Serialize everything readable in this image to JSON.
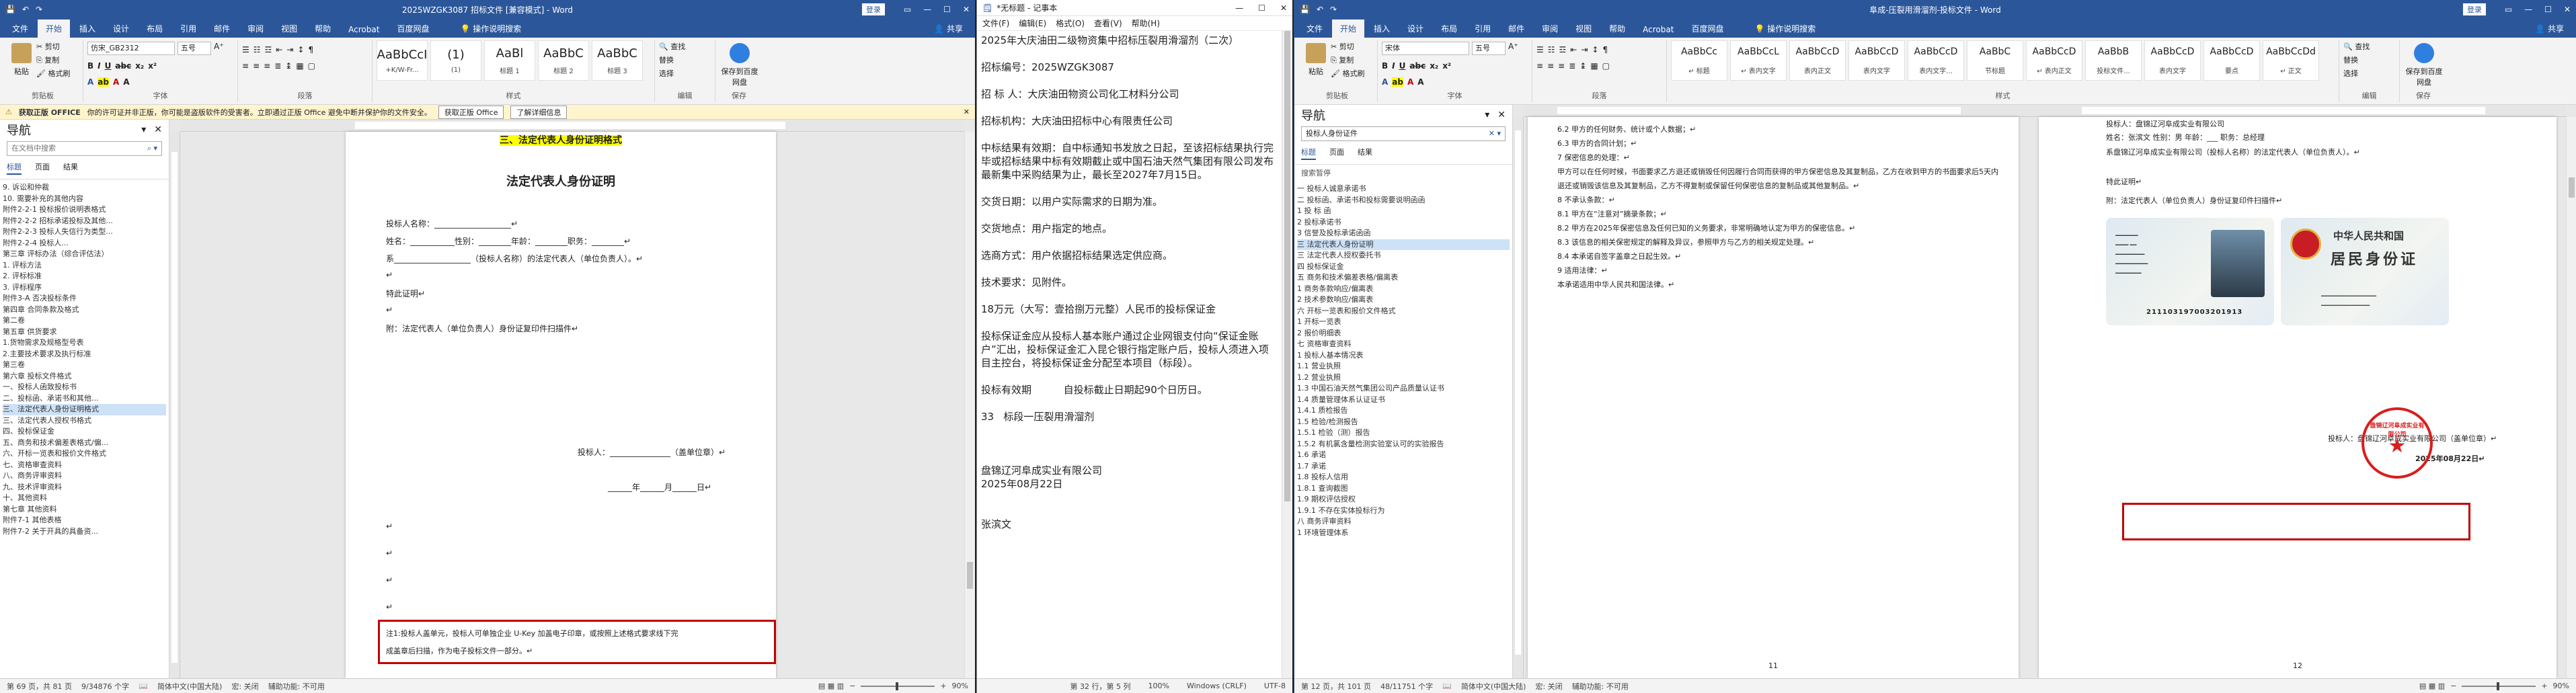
{
  "word_left": {
    "title": "2025WZGK3087 招标文件 [兼容模式] - Word",
    "signin": "登录",
    "tabs": [
      "文件",
      "开始",
      "插入",
      "设计",
      "布局",
      "引用",
      "邮件",
      "审阅",
      "视图",
      "帮助",
      "Acrobat",
      "百度网盘"
    ],
    "tell_me": "操作说明搜索",
    "share": "共享",
    "ribbon": {
      "clipboard_label": "剪贴板",
      "paste": "粘贴",
      "cut": "✂ 剪切",
      "copy": "⎘ 复制",
      "format_painter": "🖌 格式刷",
      "font_label": "字体",
      "font_name": "仿宋_GB2312",
      "font_size": "五号",
      "paragraph_label": "段落",
      "styles_label": "样式",
      "styles": [
        {
          "preview": "AaBbCcI",
          "name": "+K/W-Fr..."
        },
        {
          "preview": "(1)",
          "name": "(1)"
        },
        {
          "preview": "AaBl",
          "name": "标题 1"
        },
        {
          "preview": "AaBbC",
          "name": "标题 2"
        },
        {
          "preview": "AaBbC",
          "name": "标题 3"
        }
      ],
      "editing_label": "编辑",
      "find": "🔍 查找",
      "replace": "替换",
      "select": "选择",
      "save_baidu": "保存到百度网盘",
      "save_label": "保存"
    },
    "infobar": {
      "title": "获取正版 OFFICE",
      "text": "你的许可证并非正版，你可能是盗版软件的受害者。立即通过正版 Office 避免中断并保护你的文件安全。",
      "btn1": "获取正版 Office",
      "btn2": "了解详细信息"
    },
    "nav": {
      "title": "导航",
      "search_placeholder": "在文档中搜索",
      "tabs": [
        "标题",
        "页面",
        "结果"
      ],
      "items": [
        "9. 诉讼和仲裁",
        "10. 需要补充的其他内容",
        "附件2-2-1 投标报价说明表格式",
        "附件2-2-2 招标承诺投标及其他...",
        "附件2-2-3 投标人失信行为类型...",
        "附件2-2-4 投标人...",
        "第三章 评标办法（综合评估法）",
        "1. 评标方法",
        "2. 评标标准",
        "3. 评标程序",
        "附件3-A 否决投标条件",
        "第四章 合同条款及格式",
        "第二卷",
        "第五章 供货要求",
        "1.货物需求及规格型号表",
        "2.主要技术要求及执行标准",
        "第三卷",
        "第六章 投标文件格式",
        "一、投标人函致投标书",
        "二、投标函、承诺书和其他...",
        "三、法定代表人身份证明格式",
        "三、法定代表人授权书格式",
        "四、投标保证金",
        "五、商务和技术偏差表格式/偏...",
        "六、开标一览表和报价文件格式",
        "七、资格审查资料",
        "八、商务评审资料",
        "九、技术评审资料",
        "十、其他资料",
        "第七章 其他资料",
        "附件7-1 其他表格",
        "附件7-2 关于开具的具备资..."
      ]
    },
    "page": {
      "top_title": "三、法定代表人身份证明格式",
      "heading": "法定代表人身份证明",
      "lines": [
        "投标人名称：___________________↵",
        "姓名：___________性别：________年龄：________职务：________↵",
        "系___________________（投标人名称）的法定代表人（单位负责人）。↵",
        "↵",
        "特此证明↵",
        "↵",
        "附：法定代表人（单位负责人）身份证复印件扫描件↵"
      ],
      "sign": "投标人：_______________（盖单位章）↵",
      "date": "______年______月______日↵",
      "note1": "注1:投标人盖单元，投标人可单独企业 U-Key 加盖电子印章，或按照上述格式要求线下完",
      "note2": "成盖章后扫描，作为电子投标文件一部分。↵"
    },
    "status": {
      "page": "第 69 页，共 81 页",
      "words": "9/34876 个字",
      "lang": "简体中文(中国大陆)",
      "macro": "宏: 关闭",
      "access": "辅助功能: 不可用",
      "zoom": "90%"
    }
  },
  "notepad": {
    "title": "*无标题 - 记事本",
    "menus": [
      "文件(F)",
      "编辑(E)",
      "格式(O)",
      "查看(V)",
      "帮助(H)"
    ],
    "lines": [
      "2025年大庆油田二级物资集中招标压裂用滑溜剂（二次）",
      "",
      "招标编号：2025WZGK3087",
      "",
      "招 标 人：大庆油田物资公司化工材料分公司",
      "",
      "招标机构：大庆油田招标中心有限责任公司",
      "",
      "中标结果有效期：自中标通知书发放之日起，至该招标结果执行完毕或招标结果中标有效期截止或中国石油天然气集团有限公司发布最新集中采购结果为止，最长至2027年7月15日。",
      "",
      "交货日期：以用户实际需求的日期为准。",
      "",
      "交货地点：用户指定的地点。",
      "",
      "选商方式：用户依据招标结果选定供应商。",
      "",
      "技术要求：见附件。",
      "",
      "18万元（大写：壹拾捌万元整）人民币的投标保证金",
      "",
      "投标保证金应从投标人基本账户通过企业网银支付向“保证金账户”汇出，投标保证金汇入昆仑银行指定账户后，投标人须进入项目主控台，将投标保证金分配至本项目（标段）。",
      "",
      "投标有效期          自投标截止日期起90个日历日。",
      "",
      "33   标段一压裂用滑溜剂",
      "",
      "",
      "",
      "盘锦辽河阜成实业有限公司",
      "2025年08月22日",
      "",
      "",
      "张滨文"
    ],
    "status": {
      "pos": "第 32 行，第 5 列",
      "zoom": "100%",
      "eol": "Windows (CRLF)",
      "enc": "UTF-8"
    }
  },
  "word_right": {
    "title": "阜成-压裂用滑溜剂-投标文件 - Word",
    "signin": "登录",
    "tabs": [
      "文件",
      "开始",
      "插入",
      "设计",
      "布局",
      "引用",
      "邮件",
      "审阅",
      "视图",
      "帮助",
      "Acrobat",
      "百度网盘"
    ],
    "tell_me": "操作说明搜索",
    "share": "共享",
    "ribbon": {
      "clipboard_label": "剪贴板",
      "paste": "粘贴",
      "cut": "✂ 剪切",
      "copy": "⎘ 复制",
      "format_painter": "🖌 格式刷",
      "font_label": "字体",
      "font_name": "宋体",
      "font_size": "五号",
      "paragraph_label": "段落",
      "styles_label": "样式",
      "styles": [
        {
          "preview": "AaBbCc",
          "name": "↵ 标题"
        },
        {
          "preview": "AaBbCcL",
          "name": "↵ 表内文字"
        },
        {
          "preview": "AaBbCcD",
          "name": "表内正文"
        },
        {
          "preview": "AaBbCcD",
          "name": "表内文字"
        },
        {
          "preview": "AaBbCcD",
          "name": "表内文字..."
        },
        {
          "preview": "AaBbC",
          "name": "节标题"
        },
        {
          "preview": "AaBbCcD",
          "name": "↵ 表内正文"
        },
        {
          "preview": "AaBbB",
          "name": "投标文件..."
        },
        {
          "preview": "AaBbCcD",
          "name": "表内文字"
        },
        {
          "preview": "AaBbCcD",
          "name": "要点"
        },
        {
          "preview": "AaBbCcDd",
          "name": "↵ 正文"
        }
      ],
      "editing_label": "编辑",
      "find": "🔍 查找",
      "replace": "替换",
      "select": "选择",
      "save_baidu": "保存到百度网盘",
      "save_label": "保存"
    },
    "nav": {
      "title": "导航",
      "search_placeholder": "投标人身份证件",
      "tabs": [
        "标题",
        "页面",
        "结果"
      ],
      "result_label": "搜索暂停",
      "items": [
        "一 投标人诚意承诺书",
        "二 投标函、承诺书和投标需要说明函函",
        "1 投 标 函",
        "2 投标承诺书",
        "3 信誉及投标承诺函函",
        "三 法定代表人身份证明",
        "三 法定代表人授权委托书",
        "四 投标保证金",
        "五 商务和技术偏差表格/偏离表",
        "1 商务条款响应/偏离表",
        "2 技术参数响应/偏离表",
        "六 开标一览表和报价文件格式",
        "1 开标一览表",
        "2 报价明细表",
        "七 资格审查资料",
        "1 投标人基本情况表",
        "1.1 营业执照",
        "1.2 营业执照",
        "1.3 中国石油天然气集团公司产品质量认证书",
        "1.4 质量管理体系认证证书",
        "1.4.1 质检报告",
        "1.5 检验/检测报告",
        "1.5.1 检验（测）报告",
        "1.5.2 有机氯含量检测实验室认可的实验报告",
        "1.6 承诺",
        "1.7 承诺",
        "1.8 投标人信用",
        "1.8.1 查询截图",
        "1.9 期权评估授权",
        "1.9.1 不存在实体投标行为",
        "八 商务评审资料",
        "1 环境管理体系"
      ]
    },
    "page_left": {
      "lines": [
        "6.2 甲方的任何财务、统计或个人数据；↵",
        "6.3 甲方的合同计划；↵",
        "7 保密信息的处理：↵",
        "  甲方可以在任何时候，书面要求乙方退还或销毁任何因履行合同而获得的甲方保密信息及其复制品，乙方在收到甲方的书面要求后5天内退还或销毁该信息及其复制品，乙方不得复制或保留任何保密信息的复制品或其他复制品。↵",
        "8 不承认条款：↵",
        "  8.1 甲方在“注意对”摘录条款；↵",
        "  8.2 甲方在2025年保密信息及任何已知的义务要求，非常明确地认定为甲方的保密信息。↵",
        "  8.3 该信息的相关保密规定的解释及异议，参照甲方与乙方的相关规定处理。↵",
        "8.4 本承诺自签字盖章之日起生效。↵",
        "9 适用法律：↵",
        "  本承诺适用中华人民共和国法律。↵"
      ]
    },
    "page_right": {
      "bidder_line": "投标人：盘锦辽河阜成实业有限公司",
      "name_line": "姓名：张滨文  性别：男  年龄：___  职务：总经理",
      "rep_line": "系盘锦辽河阜成实业有限公司（投标人名称）的法定代表人（单位负责人）。↵",
      "cert": "特此证明↵",
      "attach": "附：法定代表人（单位负责人）身份证复印件扫描件↵",
      "card_back_title": "中华人民共和国",
      "card_back_sub": "居民身份证",
      "card_front_num": "211103197003201913",
      "sign": "投标人：盘锦辽河阜成实业有限公司（盖单位章）↵",
      "date": "2025年08月22日↵",
      "stamp_text": "盘锦辽河阜成实业有限公司"
    },
    "status": {
      "page": "第 12 页，共 101 页",
      "words": "48/11751 个字",
      "lang": "简体中文(中国大陆)",
      "macro": "宏: 关闭",
      "access": "辅助功能: 不可用",
      "zoom": "90%"
    }
  },
  "colors": {
    "word_blue": "#2b579a",
    "highlight": "#ffff00",
    "red_box": "#c00000"
  }
}
